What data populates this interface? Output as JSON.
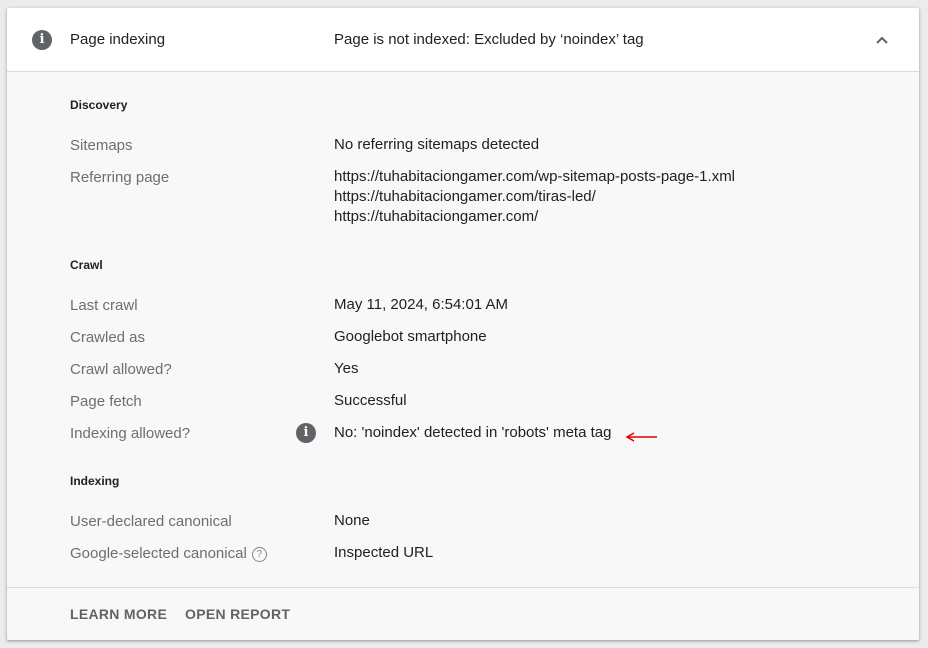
{
  "header": {
    "title": "Page indexing",
    "status": "Page is not indexed: Excluded by ‘noindex’ tag",
    "info_icon": "info-icon",
    "collapse_icon": "chevron-up-icon"
  },
  "discovery": {
    "title": "Discovery",
    "sitemaps_label": "Sitemaps",
    "sitemaps_value": "No referring sitemaps detected",
    "referring_label": "Referring page",
    "referring_values": [
      "https://tuhabitaciongamer.com/wp-sitemap-posts-page-1.xml",
      "https://tuhabitaciongamer.com/tiras-led/",
      "https://tuhabitaciongamer.com/"
    ]
  },
  "crawl": {
    "title": "Crawl",
    "last_crawl_label": "Last crawl",
    "last_crawl_value": "May 11, 2024, 6:54:01 AM",
    "crawled_as_label": "Crawled as",
    "crawled_as_value": "Googlebot smartphone",
    "crawl_allowed_label": "Crawl allowed?",
    "crawl_allowed_value": "Yes",
    "page_fetch_label": "Page fetch",
    "page_fetch_value": "Successful",
    "indexing_allowed_label": "Indexing allowed?",
    "indexing_allowed_value": "No: 'noindex' detected in 'robots' meta tag"
  },
  "indexing": {
    "title": "Indexing",
    "user_canonical_label": "User-declared canonical",
    "user_canonical_value": "None",
    "google_canonical_label": "Google-selected canonical",
    "google_canonical_value": "Inspected URL"
  },
  "footer": {
    "learn_more": "LEARN MORE",
    "open_report": "OPEN REPORT"
  },
  "colors": {
    "annotation_arrow": "#e00000",
    "icon_gray": "#5f6368"
  }
}
